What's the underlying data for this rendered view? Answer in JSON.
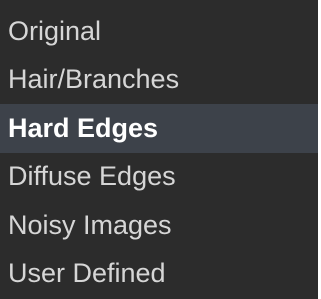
{
  "menu": {
    "items": [
      {
        "label": "Original",
        "selected": false
      },
      {
        "label": "Hair/Branches",
        "selected": false
      },
      {
        "label": "Hard Edges",
        "selected": true
      },
      {
        "label": "Diffuse Edges",
        "selected": false
      },
      {
        "label": "Noisy Images",
        "selected": false
      },
      {
        "label": "User Defined",
        "selected": false
      }
    ]
  },
  "colors": {
    "background": "#2c2c2c",
    "selected_background": "#3d424a",
    "text": "#d6d6d6",
    "selected_text": "#ffffff"
  }
}
